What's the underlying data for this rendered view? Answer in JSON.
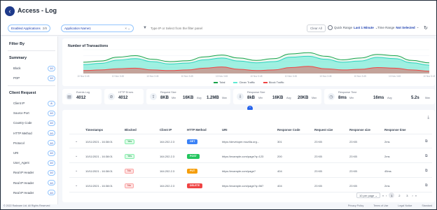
{
  "header": {
    "title": "Access - Log"
  },
  "toolbar": {
    "chip_apps_label": "Enabled Applications",
    "chip_apps_count": "2/8",
    "chip_name_label": "Application Name1",
    "search_placeholder": "Type IP or Select from the filter panel",
    "clear_all": "Clear All",
    "quick_range_label": "Quick Range",
    "quick_range_value": "Last 1 Minute",
    "time_range_label": "Time Range",
    "time_range_value": "Not Selected"
  },
  "sidebar": {
    "title": "Filter By",
    "summary_title": "Summary",
    "summary_items": [
      {
        "label": "Block",
        "count": "10"
      },
      {
        "label": "POP",
        "count": "10"
      }
    ],
    "client_title": "Client Request",
    "client_items": [
      {
        "label": "Client IP",
        "count": "8"
      },
      {
        "label": "Source Port",
        "count": "10"
      },
      {
        "label": "Country Code",
        "count": "10"
      },
      {
        "label": "HTTP Method",
        "count": "10"
      },
      {
        "label": "Protocol",
        "count": "10"
      },
      {
        "label": "URI",
        "count": "10"
      },
      {
        "label": "User_Agent",
        "count": "10"
      },
      {
        "label": "Real IP Header",
        "count": "10"
      },
      {
        "label": "Real IP Header",
        "count": "10"
      },
      {
        "label": "Real IP Header",
        "count": "10"
      }
    ]
  },
  "chart": {
    "title": "Number of Transactions",
    "legend": [
      {
        "name": "Total",
        "color": "#16a34a"
      },
      {
        "name": "Clean Traffic",
        "color": "#5eead4"
      },
      {
        "name": "Block Traffic",
        "color": "#ef4444"
      }
    ]
  },
  "chart_data": {
    "type": "area",
    "title": "Number of Transactions",
    "x": [
      "10 Nov 3:45",
      "",
      "10 Nov 3:45",
      "",
      "10 Nov 3:45",
      "",
      "10 Nov 3:45",
      "",
      "10 Nov 3:45",
      "",
      "10 Nov 3:45",
      "",
      "10 Nov 3:45",
      "",
      "10 Nov 3:45",
      "",
      "10 Nov 3:45",
      "",
      "10 Nov 3:45",
      "",
      "10 Nov 3:45"
    ],
    "series": [
      {
        "name": "Total",
        "values": [
          38,
          42,
          55,
          60,
          48,
          40,
          43,
          56,
          62,
          52,
          44,
          50,
          66,
          70,
          58,
          46,
          52,
          64,
          60,
          44,
          36
        ]
      },
      {
        "name": "Clean Traffic",
        "values": [
          30,
          34,
          45,
          50,
          40,
          32,
          35,
          46,
          52,
          42,
          36,
          40,
          55,
          58,
          48,
          38,
          42,
          54,
          50,
          36,
          28
        ]
      },
      {
        "name": "Block Traffic",
        "values": [
          10,
          12,
          16,
          18,
          12,
          10,
          12,
          18,
          22,
          14,
          10,
          12,
          20,
          24,
          16,
          12,
          14,
          20,
          18,
          12,
          8
        ]
      }
    ],
    "ylim": [
      0,
      80
    ],
    "grid": true,
    "legend_placement": "bottom"
  },
  "stats": [
    {
      "icon": "log-icon",
      "label": "Events Log",
      "value": "4012"
    },
    {
      "icon": "eye-off-icon",
      "label": "HTTP Errors",
      "value": "4012"
    },
    {
      "icon": "upload-icon",
      "label": "Request Size",
      "min_value": "8KB",
      "min_label": "Min",
      "avg_value": "16KB",
      "avg_label": "Avg",
      "max_value": "1.2MB",
      "max_label": "Max"
    },
    {
      "icon": "download-icon",
      "label": "Response Size",
      "min_value": "8kB",
      "min_label": "Min",
      "avg_value": "16KB",
      "avg_label": "Avg",
      "max_value": "20KB",
      "max_label": "Max"
    },
    {
      "icon": "clock-icon",
      "label": "Response Time",
      "min_value": "8ms",
      "min_label": "Min",
      "avg_value": "16ms",
      "avg_label": "Avg",
      "max_value": "5.2s",
      "max_label": "Max"
    }
  ],
  "table": {
    "headers": [
      "Timestamps",
      "Blocked",
      "Client IP",
      "HTTP Method",
      "URI",
      "Response Code",
      "Request size",
      "Response size",
      "Response time"
    ],
    "rows": [
      {
        "ts": "10/11/2021 - 16:38:01",
        "blocked": "Yes",
        "ip": "164.202.2.3",
        "method": "GET",
        "method_color": "#3b82f6",
        "uri": "https://developer.mozilla.org...",
        "code": "301",
        "req": "23 KB",
        "res": "23 KB",
        "time": "2ms"
      },
      {
        "ts": "10/11/2021 - 16:38:01",
        "blocked": "Yes",
        "ip": "164.202.2.3",
        "method": "POST",
        "method_color": "#22c55e",
        "uri": "https://example.com/page?q=123",
        "code": "200",
        "req": "23 KB",
        "res": "23 KB",
        "time": "2ms"
      },
      {
        "ts": "10/11/2021 - 16:38:01",
        "blocked": "No",
        "ip": "164.202.2.3",
        "method": "PUT",
        "method_color": "#f59e0b",
        "uri": "https://example.com/page?",
        "code": "404",
        "req": "23 KB",
        "res": "23 KB",
        "time": "45ms"
      },
      {
        "ts": "10/11/2021 - 16:38:01",
        "blocked": "No",
        "ip": "164.202.2.3",
        "method": "DELETE",
        "method_color": "#ef4444",
        "uri": "https://example.com/page?q=567",
        "code": "404",
        "req": "23 KB",
        "res": "23 KB",
        "time": "2ms"
      }
    ]
  },
  "pager": {
    "per_page": "10 per page",
    "pages": [
      "1",
      "2",
      "3"
    ]
  },
  "footer": {
    "copyright": "© 2022 Radware Ltd. All Rights Reserved",
    "links": [
      "Privacy Policy",
      "Terms of Use",
      "Legal Notice",
      "Standard"
    ]
  }
}
